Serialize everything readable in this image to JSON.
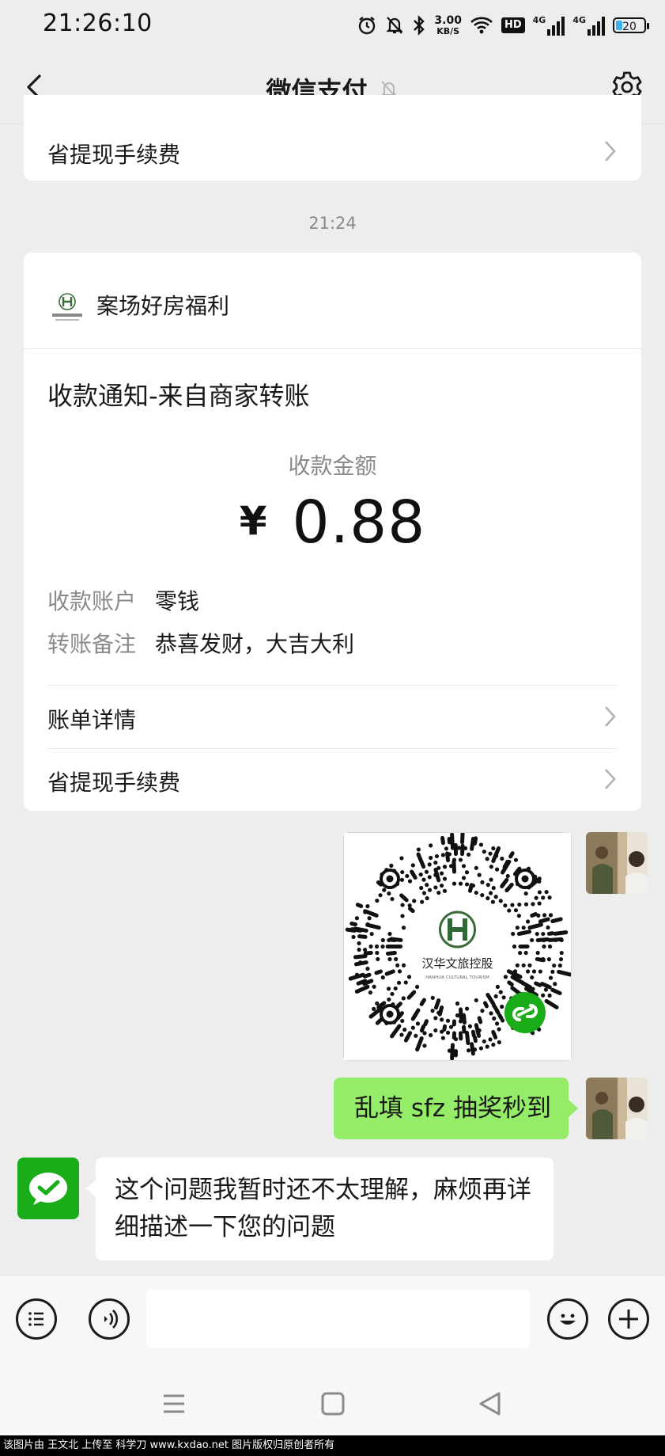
{
  "status_bar": {
    "time": "21:26:10",
    "net_speed_value": "3.00",
    "net_speed_unit": "KB/S",
    "hd_badge": "HD",
    "signal_1": "4G",
    "signal_2": "4G",
    "battery": "20"
  },
  "header": {
    "title": "微信支付"
  },
  "previous_card": {
    "row_label": "省提现手续费"
  },
  "timestamp": "21:24",
  "notice_card": {
    "merchant_name": "案场好房福利",
    "merchant_logo_text": "汉华文旅控股",
    "title": "收款通知-来自商家转账",
    "amount_label": "收款金额",
    "currency": "¥",
    "amount": "0.88",
    "fields": [
      {
        "key": "收款账户",
        "value": "零钱"
      },
      {
        "key": "转账备注",
        "value": "恭喜发财，大吉大利"
      }
    ],
    "links": [
      "账单详情",
      "省提现手续费"
    ]
  },
  "chat": {
    "qr_center_text": "汉华文旅控股",
    "qr_sub_text": "HANHUA CULTURAL TOURISM",
    "user_message": "乱填 sfz 抽奖秒到",
    "bot_message": "这个问题我暂时还不太理解，麻烦再详细描述一下您的问题"
  },
  "input_bar": {
    "placeholder": ""
  },
  "watermark": "该图片由 王文北 上传至 科学刀 www.kxdao.net 图片版权归原创者所有",
  "colors": {
    "background": "#ededed",
    "card": "#ffffff",
    "user_bubble": "#95ec69",
    "wechat_green": "#1aad19",
    "muted_text": "#8a8a8a"
  },
  "icons": [
    "back-arrow-icon",
    "mute-bell-icon",
    "gear-icon",
    "chevron-right-icon",
    "menu-list-icon",
    "voice-icon",
    "emoji-icon",
    "plus-icon",
    "wechat-pay-check-icon",
    "mini-program-icon"
  ]
}
